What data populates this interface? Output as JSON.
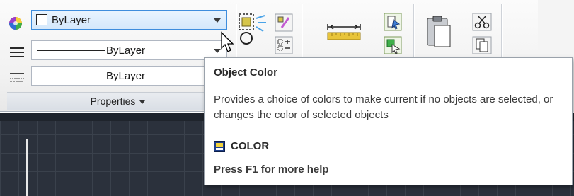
{
  "properties_panel": {
    "color_combo": {
      "value": "ByLayer"
    },
    "linetype_combo": {
      "value": "ByLayer"
    },
    "lineweight_combo": {
      "value": "ByLayer"
    },
    "panel_label": "Properties"
  },
  "tooltip": {
    "title": "Object Color",
    "description": "Provides a choice of colors to make current if no objects are selected, or changes the color of selected objects",
    "command": "COLOR",
    "help": "Press F1 for more help"
  },
  "colors": {
    "active_combo": "#3e8ddd",
    "drawing_bg": "#2b313c"
  }
}
